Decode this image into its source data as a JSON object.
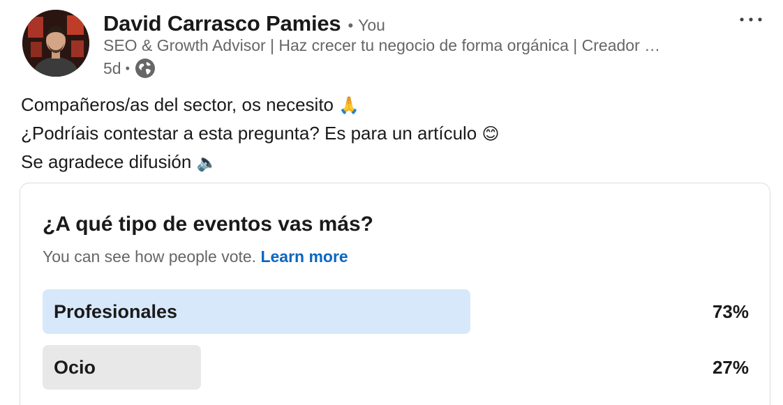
{
  "post": {
    "author_name": "David Carrasco Pamies",
    "you_label": "You",
    "headline": "SEO & Growth Advisor | Haz crecer tu negocio de forma orgánica | Creador …",
    "age": "5d",
    "visibility_icon": "globe-icon",
    "more_icon": "more-horizontal-icon",
    "text_lines": [
      {
        "text": "Compañeros/as del sector, os necesito",
        "emoji": "🙏"
      },
      {
        "text": "¿Podríais contestar a esta pregunta? Es para un artículo",
        "emoji": "😊"
      },
      {
        "text": "Se agradece difusión",
        "emoji": "🔈"
      }
    ]
  },
  "poll": {
    "question": "¿A qué tipo de eventos vas más?",
    "note": "You can see how people vote.",
    "learn_more": "Learn more",
    "options": [
      {
        "label": "Profesionales",
        "percent_label": "73%",
        "share": 0.73,
        "color": "#d7e8fb",
        "selected": true
      },
      {
        "label": "Ocio",
        "percent_label": "27%",
        "share": 0.27,
        "color": "#e8e8e8",
        "selected": false
      }
    ]
  },
  "colors": {
    "link": "#0a66c2",
    "muted_text": "#666666",
    "selected_bar": "#d7e8fb",
    "other_bar": "#e8e8e8"
  }
}
